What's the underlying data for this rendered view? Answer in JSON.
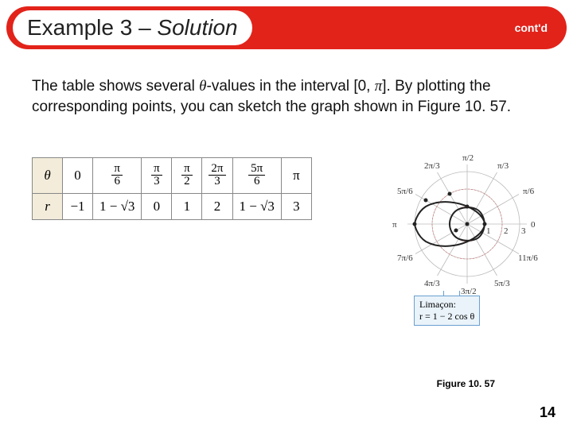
{
  "header": {
    "title_plain": "Example 3 – ",
    "title_italic": "Solution",
    "contd": "cont'd"
  },
  "body": {
    "text_1": "The table shows several ",
    "theta": "θ",
    "text_2": "-values in the interval [0, ",
    "pi": "π",
    "text_3": "]. By plotting the corresponding points, you can sketch the graph shown in Figure 10. 57."
  },
  "table": {
    "row1_head": "θ",
    "row2_head": "r",
    "cols": [
      {
        "theta_plain": "0",
        "r": "−1"
      },
      {
        "theta_num": "π",
        "theta_den": "6",
        "r_expr": "1 − √3"
      },
      {
        "theta_num": "π",
        "theta_den": "3",
        "r": "0"
      },
      {
        "theta_num": "π",
        "theta_den": "2",
        "r": "1"
      },
      {
        "theta_num": "2π",
        "theta_den": "3",
        "r": "2"
      },
      {
        "theta_num": "5π",
        "theta_den": "6",
        "r_expr": "1 − √3"
      },
      {
        "theta_plain": "π",
        "r": "3"
      }
    ]
  },
  "chart_data": {
    "type": "polar",
    "title": "Limaçon r = 1 − 2 cos θ",
    "equation": "r = 1 − 2 cos θ",
    "angle_labels": [
      "0",
      "π/6",
      "π/3",
      "π/2",
      "2π/3",
      "5π/6",
      "π",
      "7π/6",
      "4π/3",
      "3π/2",
      "5π/3",
      "11π/6"
    ],
    "radial_ticks": [
      1,
      2,
      3
    ],
    "sample_points": [
      {
        "theta": 0,
        "r": -1
      },
      {
        "theta": 0.5236,
        "r": -0.732
      },
      {
        "theta": 1.0472,
        "r": 0
      },
      {
        "theta": 1.5708,
        "r": 1
      },
      {
        "theta": 2.0944,
        "r": 2
      },
      {
        "theta": 2.618,
        "r": 2.732
      },
      {
        "theta": 3.1416,
        "r": 3
      }
    ],
    "callout_title": "Limaçon:",
    "callout_eq": "r = 1 − 2 cos θ"
  },
  "figure_label": "Figure 10. 57",
  "page_number": "14"
}
